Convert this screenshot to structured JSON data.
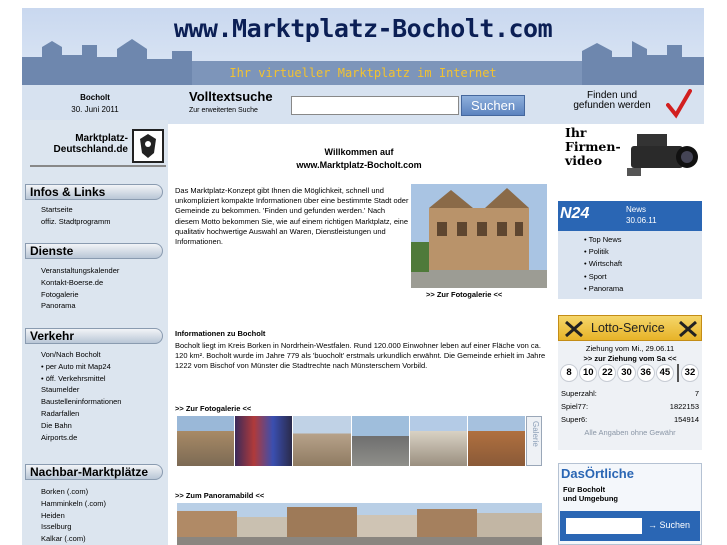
{
  "header": {
    "title": "www.Marktplatz-Bocholt.com",
    "tagline": "Ihr virtueller Marktplatz im Internet"
  },
  "subheader": {
    "city": "Bocholt",
    "date": "30. Juni 2011",
    "search_title": "Volltextsuche",
    "search_sub": "Zur erweiterten Suche",
    "search_value": "",
    "search_button": "Suchen",
    "finden_line1": "Finden und",
    "finden_line2": "gefunden werden"
  },
  "sidebar": {
    "logo_line1": "Marktplatz-",
    "logo_line2": "Deutschland.de",
    "sections": [
      {
        "title": "Infos & Links",
        "items": [
          "Startseite",
          "offiz. Stadtprogramm"
        ]
      },
      {
        "title": "Dienste",
        "items": [
          "Veranstaltungskalender",
          "Kontakt-Boerse.de",
          "Fotogalerie",
          "Panorama"
        ]
      },
      {
        "title": "Verkehr",
        "items": [
          "Von/Nach Bocholt",
          "• per Auto mit Map24",
          "• öff. Verkehrsmittel",
          "Staumelder",
          "Baustelleninformationen",
          "Radarfallen",
          "Die Bahn",
          "Airports.de"
        ]
      },
      {
        "title": "Nachbar-Marktplätze",
        "items": [
          "Borken (.com)",
          "Hamminkeln (.com)",
          "Heiden",
          "Isselburg",
          "Kalkar (.com)"
        ]
      }
    ]
  },
  "main": {
    "welcome_line1": "Willkommen auf",
    "welcome_line2": "www.Marktplatz-Bocholt.com",
    "intro": "Das Marktplatz-Konzept gibt Ihnen die Möglichkeit, schnell und unkompliziert kompakte Informationen über eine bestimmte Stadt oder Gemeinde zu bekommen. 'Finden und gefunden werden.' Nach diesem Motto bekommen Sie, wie auf einem richtigen Marktplatz, eine qualitativ hochwertige Auswahl an Waren, Dienstleistungen und Informationen.",
    "town_link": ">> Zur Fotogalerie <<",
    "info_head": "Informationen zu Bocholt",
    "info_text": "Bocholt liegt im Kreis Borken in Nordrhein-Westfalen. Rund 120.000 Einwohner leben auf einer Fläche von ca. 120 km². Bocholt wurde im Jahre 779 als 'buocholt' erstmals urkundlich erwähnt. Die Gemeinde erhielt im Jahre 1222 vom Bischof von Münster die Stadtrechte nach Münsterschem Vorbild.",
    "gallery_link": ">> Zur Fotogalerie <<",
    "gallery_tab": "Galerie",
    "pano_link": ">> Zum Panoramabild <<"
  },
  "right": {
    "video_line1": "Ihr",
    "video_line2": "Firmen-",
    "video_line3": "video",
    "n24_logo": "N24",
    "n24_news": "News",
    "n24_date": "30.06.11",
    "n24_items": [
      "• Top News",
      "• Politik",
      "• Wirtschaft",
      "• Sport",
      "• Panorama"
    ],
    "lotto_title": "Lotto-Service",
    "lotto_line1": "Ziehung vom Mi., 29.06.11",
    "lotto_line2": ">> zur Ziehung vom Sa <<",
    "lotto_numbers": [
      "8",
      "10",
      "22",
      "30",
      "36",
      "45"
    ],
    "lotto_extra": "32",
    "rows": [
      {
        "label": "Superzahl:",
        "value": "7"
      },
      {
        "label": "Spiel77:",
        "value": "1822153"
      },
      {
        "label": "Super6:",
        "value": "154914"
      }
    ],
    "lotto_note": "Alle Angaben ohne Gewähr",
    "oe_logo": "DasÖrtliche",
    "oe_line1": "Für Bocholt",
    "oe_line2": "und Umgebung",
    "oe_button": "→ Suchen"
  }
}
